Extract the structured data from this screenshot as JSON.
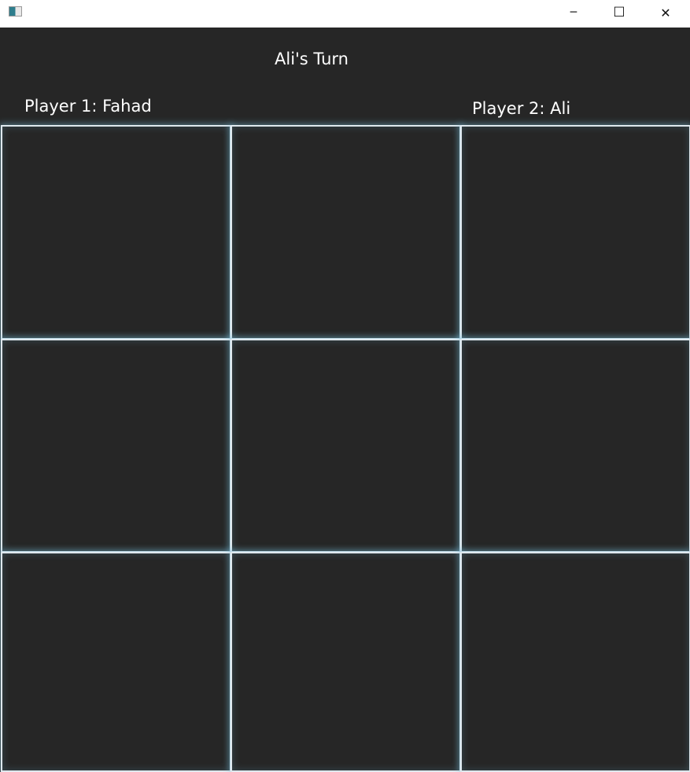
{
  "window": {
    "app_icon": "app-window-icon",
    "controls": {
      "minimize": "─",
      "maximize": "☐",
      "close": "✕"
    }
  },
  "game": {
    "turn_label": "Ali's Turn",
    "player1_label": "Player 1: Fahad",
    "player2_label": "Player 2: Ali",
    "board": [
      [
        "",
        "",
        ""
      ],
      [
        "",
        "",
        ""
      ],
      [
        "",
        "",
        ""
      ]
    ]
  },
  "colors": {
    "background": "#262626",
    "cell_border": "#dfe8ee",
    "glow": "#78bedc"
  }
}
